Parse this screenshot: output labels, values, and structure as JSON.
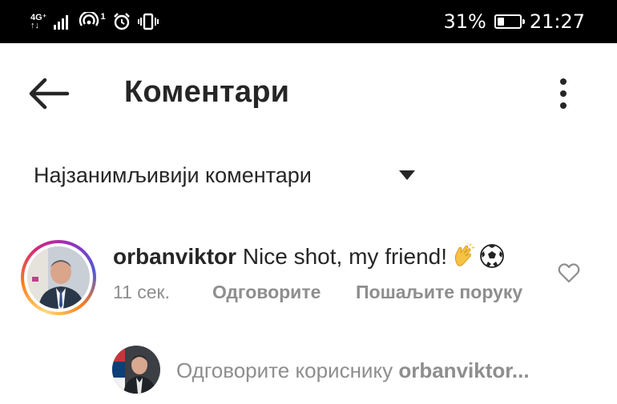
{
  "status_bar": {
    "network_type_top": "4G⁺",
    "network_type_bottom": "↑↓",
    "wifi_badge": "1",
    "battery_percent": "31%",
    "battery_level": 0.31,
    "time": "21:27"
  },
  "header": {
    "title": "Коментари",
    "back_icon": "arrow-left-icon",
    "menu_icon": "more-vertical-icon"
  },
  "sort": {
    "label": "Најзанимљивији коментари",
    "dropdown_icon": "caret-down-icon"
  },
  "comment": {
    "username": "orbanviktor",
    "text": "Nice shot, my friend!",
    "emojis": [
      "clapping-hands-icon",
      "soccer-ball-icon"
    ],
    "time": "11 сек.",
    "reply_label": "Одговорите",
    "send_message_label": "Пошаљите поруку",
    "like_icon": "heart-outline-icon"
  },
  "reply_box": {
    "prompt_prefix": "Одговорите кориснику ",
    "prompt_username": "orbanviktor..."
  },
  "colors": {
    "text_primary": "#262626",
    "text_secondary": "#8e8e8e",
    "status_bar_bg": "#000000",
    "story_ring_start": "#feda75",
    "story_ring_end": "#962fbf"
  }
}
